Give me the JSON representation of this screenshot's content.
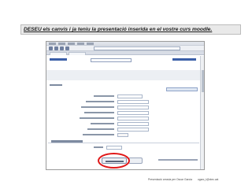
{
  "slide": {
    "title": "DESEU els canvis i ja teniu la presentació inserida en el vostre curs moodle.",
    "credit_author": "Presentació creada per Oscar Garcia",
    "credit_email": "ogarc_t@xtec.cat"
  },
  "colors": {
    "highlight": "#e01818",
    "link": "#3b5fa8"
  }
}
